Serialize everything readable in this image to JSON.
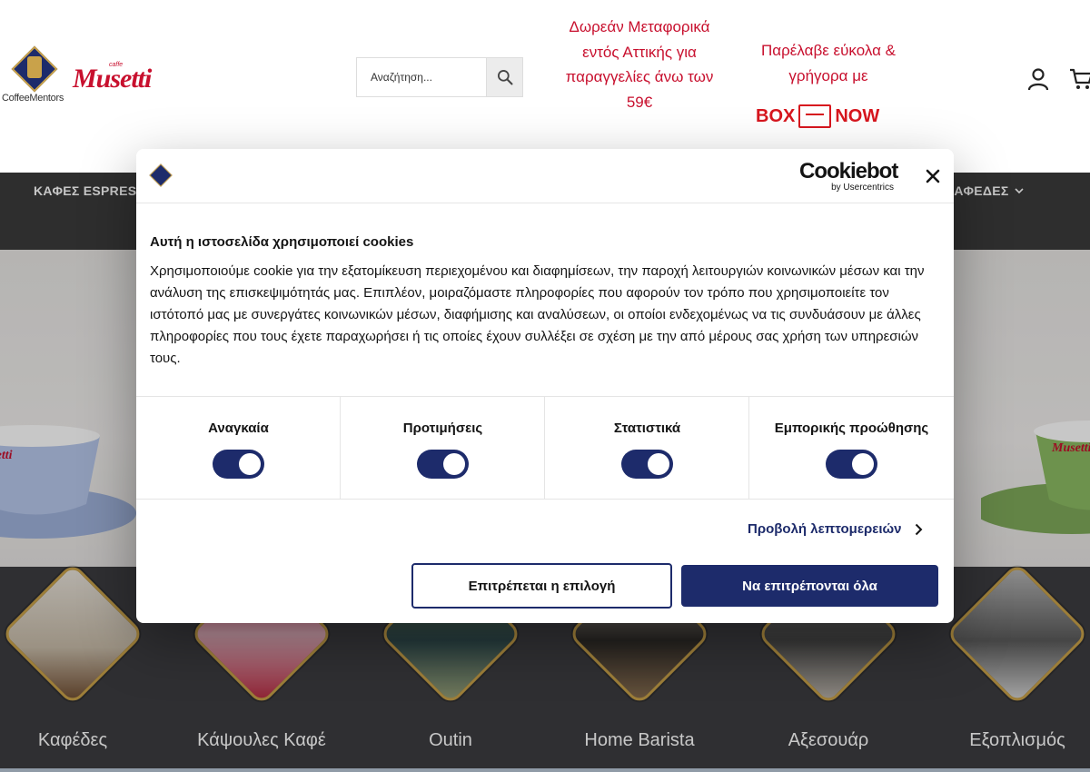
{
  "header": {
    "logo_brand": "Musetti",
    "logo_caffe": "caffe",
    "logo_mentors": "CoffeeMentors",
    "search_placeholder": "Αναζήτηση...",
    "promo_free_shipping": "Δωρεάν Μεταφορικά εντός Αττικής για παραγγελίες άνω των 59€",
    "promo_pickup": "Παρέλαβε εύκολα & γρήγορα με",
    "boxnow_left": "BOX",
    "boxnow_right": "NOW"
  },
  "nav": {
    "item_left": "ΚΑΦΕΣ ESPRESSO",
    "item_right": "ΚΑΦΕΔΕΣ"
  },
  "categories": [
    {
      "label": "Καφέδες",
      "icon": "coffee-bag"
    },
    {
      "label": "Κάψουλες Καφέ",
      "icon": "capsule-boxes"
    },
    {
      "label": "Outin",
      "icon": "portable-espresso"
    },
    {
      "label": "Home Barista",
      "icon": "grinder"
    },
    {
      "label": "Αξεσουάρ",
      "icon": "barista-tools"
    },
    {
      "label": "Εξοπλισμός",
      "icon": "espresso-machine"
    }
  ],
  "cookie": {
    "brand": "Cookiebot",
    "brand_by": "by Usercentrics",
    "title": "Αυτή η ιστοσελίδα χρησιμοποιεί cookies",
    "body": "Χρησιμοποιούμε cookie για την εξατομίκευση περιεχομένου και διαφημίσεων, την παροχή λειτουργιών κοινωνικών μέσων και την ανάλυση της επισκεψιμότητάς μας. Επιπλέον, μοιραζόμαστε πληροφορίες που αφορούν τον τρόπο που χρησιμοποιείτε τον ιστότοπό μας με συνεργάτες κοινωνικών μέσων, διαφήμισης και αναλύσεων, οι οποίοι ενδεχομένως να τις συνδυάσουν με άλλες πληροφορίες που τους έχετε παραχωρήσει ή τις οποίες έχουν συλλέξει σε σχέση με την από μέρους σας χρήση των υπηρεσιών τους.",
    "toggles": [
      {
        "label": "Αναγκαία",
        "on": true
      },
      {
        "label": "Προτιμήσεις",
        "on": true
      },
      {
        "label": "Στατιστικά",
        "on": true
      },
      {
        "label": "Εμπορικής προώθησης",
        "on": true
      }
    ],
    "details_label": "Προβολή λεπτομερειών",
    "allow_selection": "Επιτρέπεται η επιλογή",
    "allow_all": "Να επιτρέπονται όλα"
  },
  "colors": {
    "brand_red": "#c8102e",
    "cookie_navy": "#1d2b6b",
    "nav_bg": "#3b3b3b",
    "gold": "#c9a24a"
  }
}
